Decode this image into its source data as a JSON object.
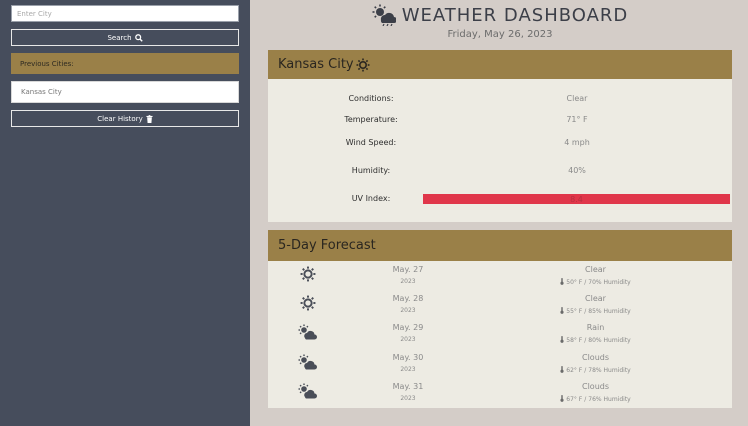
{
  "sidebar": {
    "city_input_placeholder": "Enter City",
    "search_label": "Search",
    "previous_header": "Previous Cities:",
    "history": [
      "Kansas City"
    ],
    "clear_label": "Clear History"
  },
  "header": {
    "title": "WEATHER DASHBOARD",
    "date": "Friday, May 26, 2023"
  },
  "current": {
    "city": "Kansas City",
    "icon": "sun-icon",
    "conditions_label": "Conditions:",
    "conditions": "Clear",
    "temperature_label": "Temperature:",
    "temperature": "71° F",
    "wind_label": "Wind Speed:",
    "wind": "4 mph",
    "humidity_label": "Humidity:",
    "humidity": "40%",
    "uv_label": "UV Index:",
    "uv": "8.4",
    "uv_color": "#e0364a"
  },
  "forecast": {
    "title": "5-Day Forecast",
    "days": [
      {
        "date": "May. 27",
        "year": "2023",
        "condition": "Clear",
        "temp": "50° F",
        "humidity": "70% Humidity",
        "icon": "sun-icon"
      },
      {
        "date": "May. 28",
        "year": "2023",
        "condition": "Clear",
        "temp": "55° F",
        "humidity": "85% Humidity",
        "icon": "sun-icon"
      },
      {
        "date": "May. 29",
        "year": "2023",
        "condition": "Rain",
        "temp": "58° F",
        "humidity": "80% Humidity",
        "icon": "sun-cloud-icon"
      },
      {
        "date": "May. 30",
        "year": "2023",
        "condition": "Clouds",
        "temp": "62° F",
        "humidity": "78% Humidity",
        "icon": "sun-cloud-icon"
      },
      {
        "date": "May. 31",
        "year": "2023",
        "condition": "Clouds",
        "temp": "67° F",
        "humidity": "76% Humidity",
        "icon": "sun-cloud-icon"
      }
    ]
  }
}
